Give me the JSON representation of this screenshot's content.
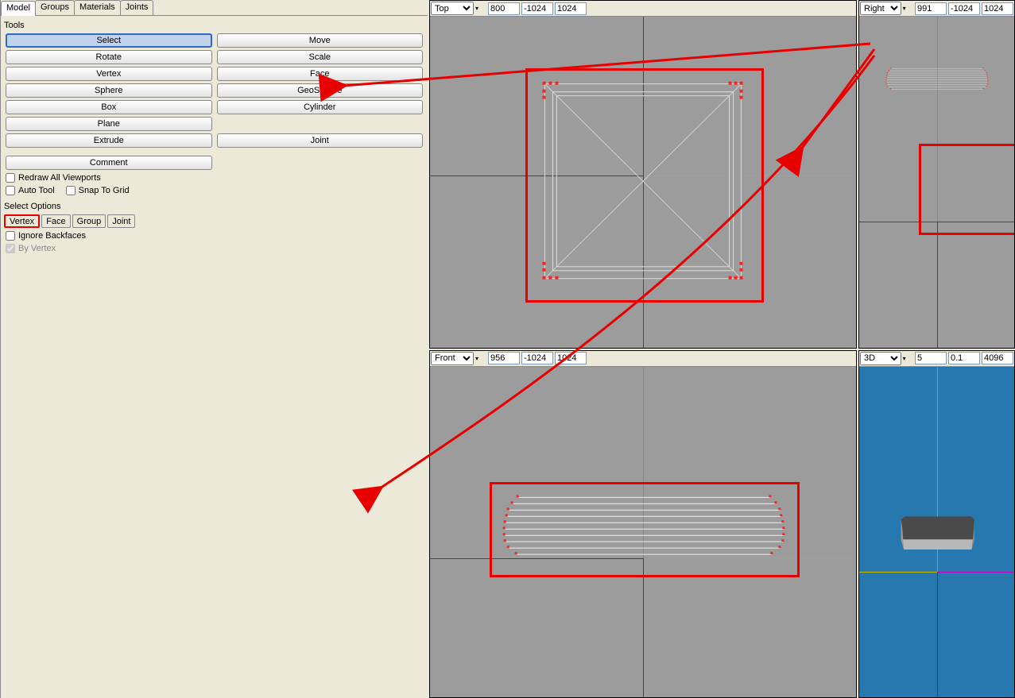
{
  "viewports": {
    "top": {
      "label": "Top",
      "v1": "800",
      "v2": "-1024",
      "v3": "1024"
    },
    "right": {
      "label": "Right",
      "v1": "991",
      "v2": "-1024",
      "v3": "1024"
    },
    "front": {
      "label": "Front",
      "v1": "956",
      "v2": "-1024",
      "v3": "1024"
    },
    "persp": {
      "label": "3D",
      "v1": "5",
      "v2": "0.1",
      "v3": "4096"
    }
  },
  "tabs": {
    "model": "Model",
    "groups": "Groups",
    "materials": "Materials",
    "joints": "Joints"
  },
  "tools": {
    "title": "Tools",
    "select": "Select",
    "move": "Move",
    "rotate": "Rotate",
    "scale": "Scale",
    "vertex": "Vertex",
    "face": "Face",
    "sphere": "Sphere",
    "geosphere": "GeoSphere",
    "box": "Box",
    "cylinder": "Cylinder",
    "plane": "Plane",
    "extrude": "Extrude",
    "joint": "Joint",
    "comment": "Comment"
  },
  "checks": {
    "redraw": "Redraw All Viewports",
    "autotool": "Auto Tool",
    "snap": "Snap To Grid"
  },
  "selectopts": {
    "title": "Select Options",
    "vertex": "Vertex",
    "face": "Face",
    "group": "Group",
    "joint": "Joint",
    "ignore": "Ignore Backfaces",
    "byvertex": "By Vertex"
  },
  "colors": {
    "bg3d": "#2878b0"
  }
}
